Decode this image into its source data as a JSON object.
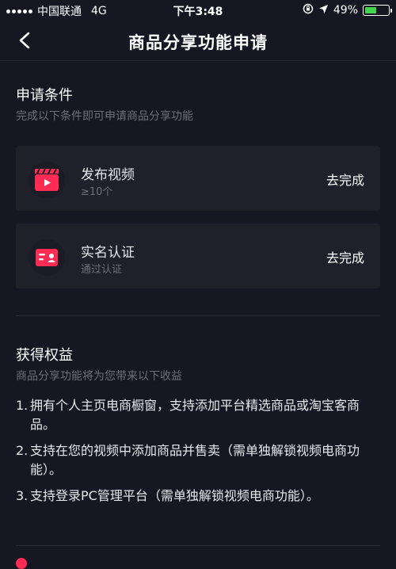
{
  "status_bar": {
    "carrier": "中国联通",
    "network": "4G",
    "time": "下午3:48",
    "battery": "49%",
    "battery_color": "#42d44c"
  },
  "nav": {
    "title": "商品分享功能申请",
    "back_icon": "chevron-left-icon"
  },
  "requirements": {
    "title": "申请条件",
    "subtitle": "完成以下条件即可申请商品分享功能",
    "items": [
      {
        "label": "发布视频",
        "detail": "≥10个",
        "action": "去完成",
        "icon": "video-clapper-icon"
      },
      {
        "label": "实名认证",
        "detail": "通过认证",
        "action": "去完成",
        "icon": "id-card-icon"
      }
    ]
  },
  "benefits": {
    "title": "获得权益",
    "subtitle": "商品分享功能将为您带来以下收益",
    "items": [
      {
        "num": "1.",
        "text": "拥有个人主页电商橱窗，支持添加平台精选商品或淘宝客商品。"
      },
      {
        "num": "2.",
        "text": "支持在您的视频中添加商品并售卖（需单独解锁视频电商功能）。"
      },
      {
        "num": "3.",
        "text": "支持登录PC管理平台（需单独解锁视频电商功能）。"
      }
    ]
  },
  "colors": {
    "background": "#161722",
    "card": "#1f2029",
    "accent": "#fe2c55"
  }
}
